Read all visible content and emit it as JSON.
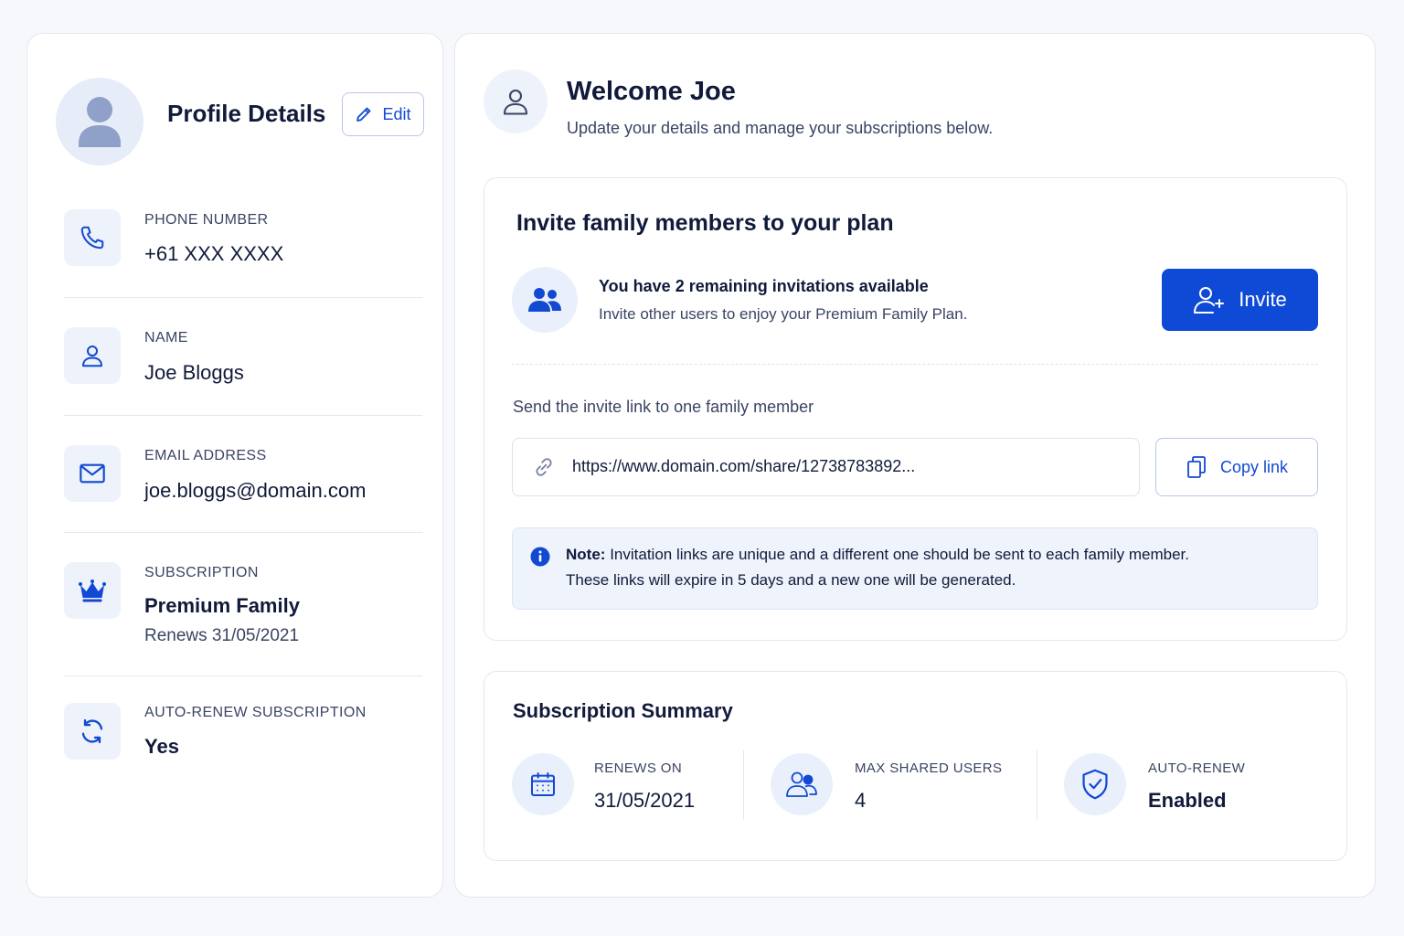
{
  "profile": {
    "title": "Profile Details",
    "edit_label": "Edit",
    "fields": [
      {
        "label": "PHONE NUMBER",
        "value": "+61 XXX XXXX",
        "icon": "phone-icon"
      },
      {
        "label": "NAME",
        "value": "Joe Bloggs",
        "icon": "user-icon"
      },
      {
        "label": "EMAIL ADDRESS",
        "value": "joe.bloggs@domain.com",
        "icon": "mail-icon"
      },
      {
        "label": "SUBSCRIPTION",
        "value": "Premium Family",
        "subvalue": "Renews 31/05/2021",
        "icon": "crown-icon"
      },
      {
        "label": "AUTO-RENEW SUBSCRIPTION",
        "value": "Yes",
        "icon": "refresh-icon"
      }
    ]
  },
  "welcome": {
    "title": "Welcome Joe",
    "subtitle": "Update your details and manage your subscriptions below."
  },
  "invite": {
    "title": "Invite family members to your plan",
    "remaining_text": "You have 2 remaining invitations available",
    "description": "Invite other users to enjoy your Premium Family Plan.",
    "button_label": "Invite",
    "link_prompt": "Send the invite link to one family member",
    "link_value": "https://www.domain.com/share/12738783892...",
    "copy_label": "Copy link",
    "note_bold": "Note:",
    "note_line1": "Invitation links are unique and a different one should be sent to each family member.",
    "note_line2": "These links will expire in 5 days and a new one will be generated."
  },
  "summary": {
    "title": "Subscription Summary",
    "items": [
      {
        "label": "RENEWS ON",
        "value": "31/05/2021",
        "icon": "calendar-icon"
      },
      {
        "label": "MAX SHARED USERS",
        "value": "4",
        "icon": "users-icon"
      },
      {
        "label": "AUTO-RENEW",
        "value": "Enabled",
        "icon": "shield-check-icon"
      }
    ]
  },
  "colors": {
    "accent": "#0f4ad6",
    "icon_bg": "#eef2fb",
    "note_bg": "#eef3fc"
  }
}
